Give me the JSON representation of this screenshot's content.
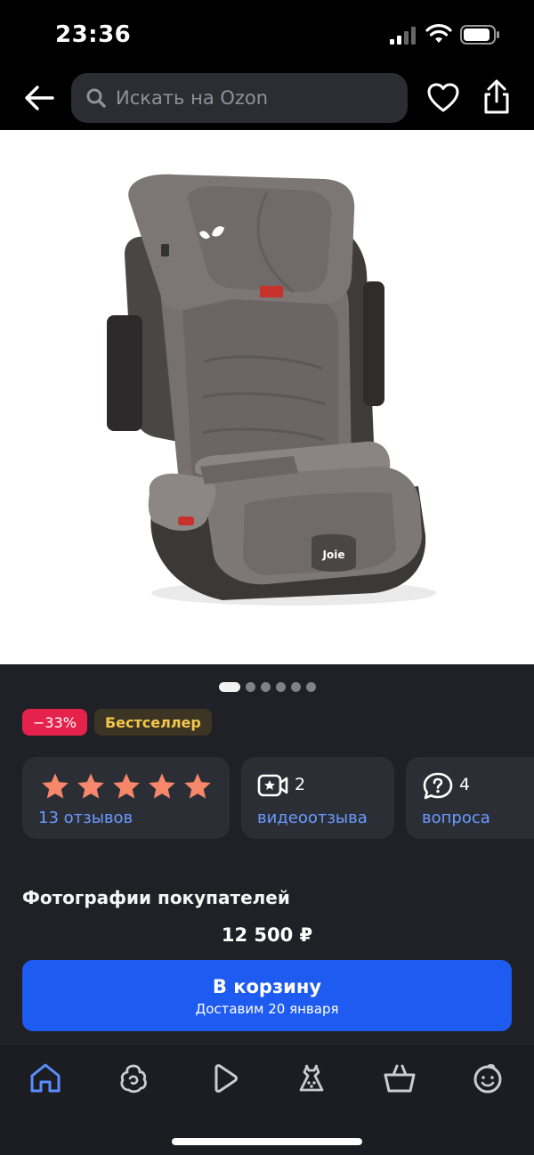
{
  "status_bar": {
    "time": "23:36"
  },
  "search": {
    "placeholder": "Искать на Ozon"
  },
  "gallery": {
    "total": 6,
    "active": 1
  },
  "badges": {
    "discount": "−33%",
    "bestseller": "Бестселлер"
  },
  "reviews": {
    "rating_stars": 5,
    "label": "13 отзывов"
  },
  "video_reviews": {
    "count": "2",
    "label": "видеоотзыва"
  },
  "questions": {
    "count": "4",
    "label": "вопроса"
  },
  "section": {
    "customer_photos": "Фотографии покупателей"
  },
  "price": "12 500 ₽",
  "cart": {
    "button_label": "В корзину",
    "delivery": "Доставим 20 января"
  },
  "brand_on_seat": "Joie",
  "colors": {
    "accent_blue": "#1e5bf0",
    "link_blue": "#6a9bff",
    "discount_red": "#e5224b",
    "star_orange": "#f7876a",
    "bestseller_text": "#f2c94c",
    "bg_dark": "#1f2127"
  },
  "tabs": [
    {
      "name": "home",
      "icon": "home-icon"
    },
    {
      "name": "fresh",
      "icon": "fresh-icon"
    },
    {
      "name": "video",
      "icon": "play-icon"
    },
    {
      "name": "fashion",
      "icon": "dress-icon"
    },
    {
      "name": "cart",
      "icon": "basket-icon"
    },
    {
      "name": "profile",
      "icon": "smile-icon"
    }
  ]
}
